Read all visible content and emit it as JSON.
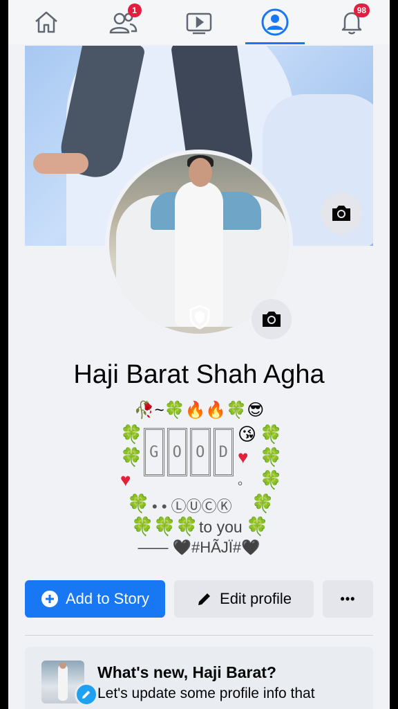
{
  "nav": {
    "tabs": [
      {
        "icon": "home-icon"
      },
      {
        "icon": "friends-icon",
        "badge": "1"
      },
      {
        "icon": "video-icon"
      },
      {
        "icon": "profile-icon",
        "active": true
      },
      {
        "icon": "bell-icon",
        "badge": "98"
      }
    ],
    "accent": "#1877f2",
    "badge_color": "#e41e3f"
  },
  "profile": {
    "name": "Haji Barat Shah Agha"
  },
  "bio": {
    "line1": "🥀~🍀🔥🔥🍀😎",
    "good_letters": [
      "G",
      "O",
      "O",
      "D"
    ],
    "kiss": "😘",
    "dot": "。",
    "luck_line": "• • ⓁⓊⒸⓀ",
    "to_you": "to you",
    "signature": "—— 🖤#HÃJÏ#🖤"
  },
  "actions": {
    "add_story": "Add to Story",
    "edit_profile": "Edit profile",
    "more": "•••"
  },
  "whats_new": {
    "title": "What's new, Haji Barat?",
    "subtitle": "Let's update some profile info that"
  }
}
